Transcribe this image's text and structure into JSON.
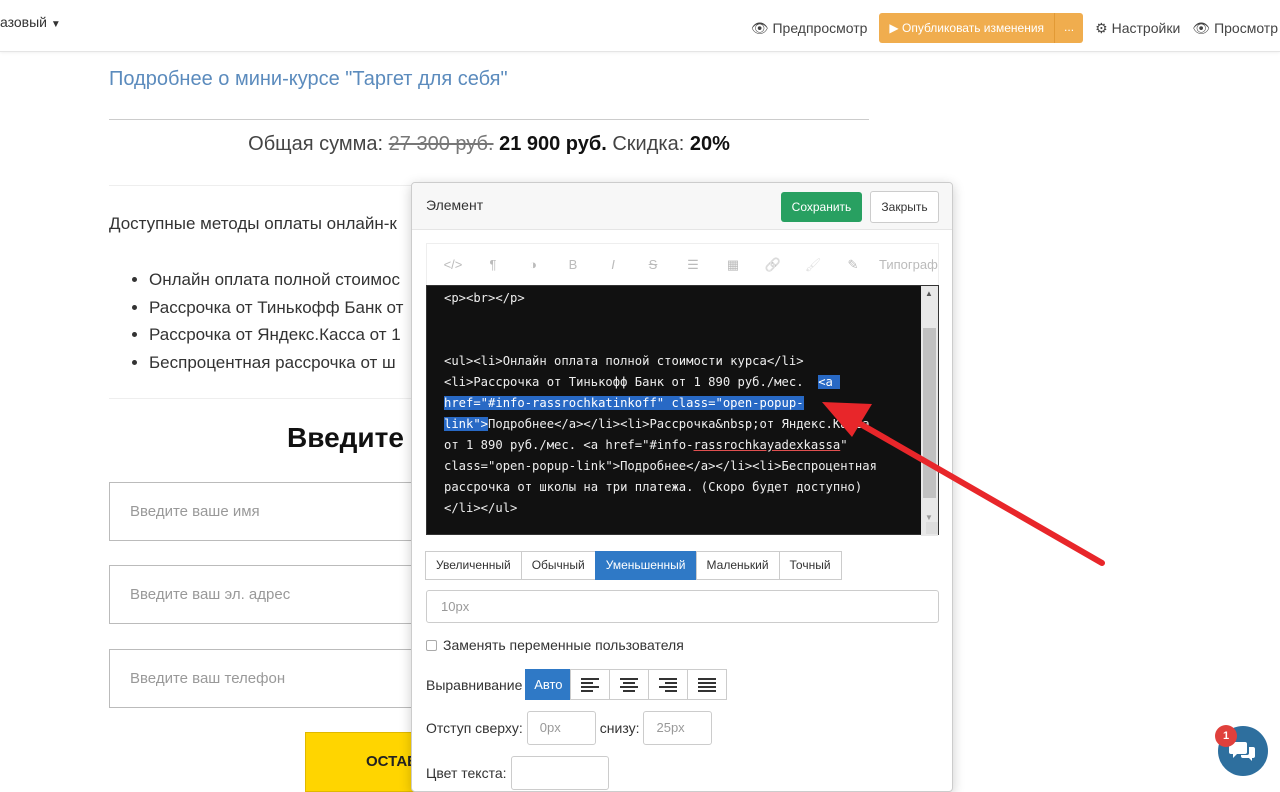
{
  "topbar": {
    "left_label": "азовый",
    "preview": "Предпросмотр",
    "publish": "Опубликовать изменения",
    "publish_more": "...",
    "settings": "Настройки",
    "view": "Просмотр"
  },
  "page": {
    "course_link": "Подробнее о мини-курсе \"Таргет для себя\"",
    "total_label": "Общая сумма:",
    "old_price": "27 300 руб.",
    "new_price": "21 900 руб.",
    "discount_label": "Скидка:",
    "discount_value": "20%",
    "methods_title": "Доступные методы оплаты онлайн-к",
    "methods": [
      "Онлайн оплата полной стоимос",
      "Рассрочка от Тинькофф Банк от",
      "Рассрочка от Яндекс.Касса от 1",
      "Беспроцентная рассрочка от ш"
    ],
    "enter_title": "Введите",
    "fields": {
      "name": "Введите ваше имя",
      "email": "Введите ваш эл. адрес",
      "phone": "Введите ваш телефон"
    },
    "cta": "ОСТАВ"
  },
  "modal": {
    "title": "Элемент",
    "save": "Сохранить",
    "close": "Закрыть",
    "toolbar": [
      "</>",
      "¶",
      "◑",
      "B",
      "I",
      "S",
      "☰",
      "▦",
      "🔗",
      "🖌",
      "✎"
    ],
    "typograf": "Типограф",
    "size_options": [
      "Увеличенный",
      "Обычный",
      "Уменьшенный",
      "Маленький",
      "Точный"
    ],
    "size_active": "Уменьшенный",
    "size_value": "10px",
    "replace_vars_label": "Заменять переменные пользователя",
    "align_label": "Выравнивание",
    "align_auto": "Авто",
    "pad_top_label": "Отступ сверху:",
    "pad_top_value": "0px",
    "pad_bottom_label": "снизу:",
    "pad_bottom_value": "25px",
    "text_color_label": "Цвет текста:"
  },
  "code": {
    "line1": "<p><br></p>",
    "line2": "<ul><li>Онлайн оплата полной стоимости курса</li>",
    "line3a": "<li>Рассрочка от Тинькофф Банк от 1 890 руб./мес.  ",
    "line3b": "<a ",
    "line4": "href=\"#info-rassrochkatinkoff\" class=\"open-popup-",
    "line5a": "link\">",
    "line5b": "Подробнее</a></li><li>Рассрочка&nbsp;от Яндекс.Касса",
    "line6a": "от 1 890 руб./мес. <a href=\"#info-",
    "line6b": "rassrochkayadexkassa",
    "line6c": "\"",
    "line7": "class=\"open-popup-link\">Подробнее</a></li><li>Беспроцентная",
    "line8": "рассрочка от школы на три платежа. (Скоро будет доступно)",
    "line9": "</li></ul>"
  },
  "chat": {
    "badge": "1"
  },
  "colors": {
    "accent_blue": "#2f79c6",
    "save_green": "#28a061",
    "publish_orange": "#f0ad4e",
    "arrow_red": "#e8262a"
  }
}
